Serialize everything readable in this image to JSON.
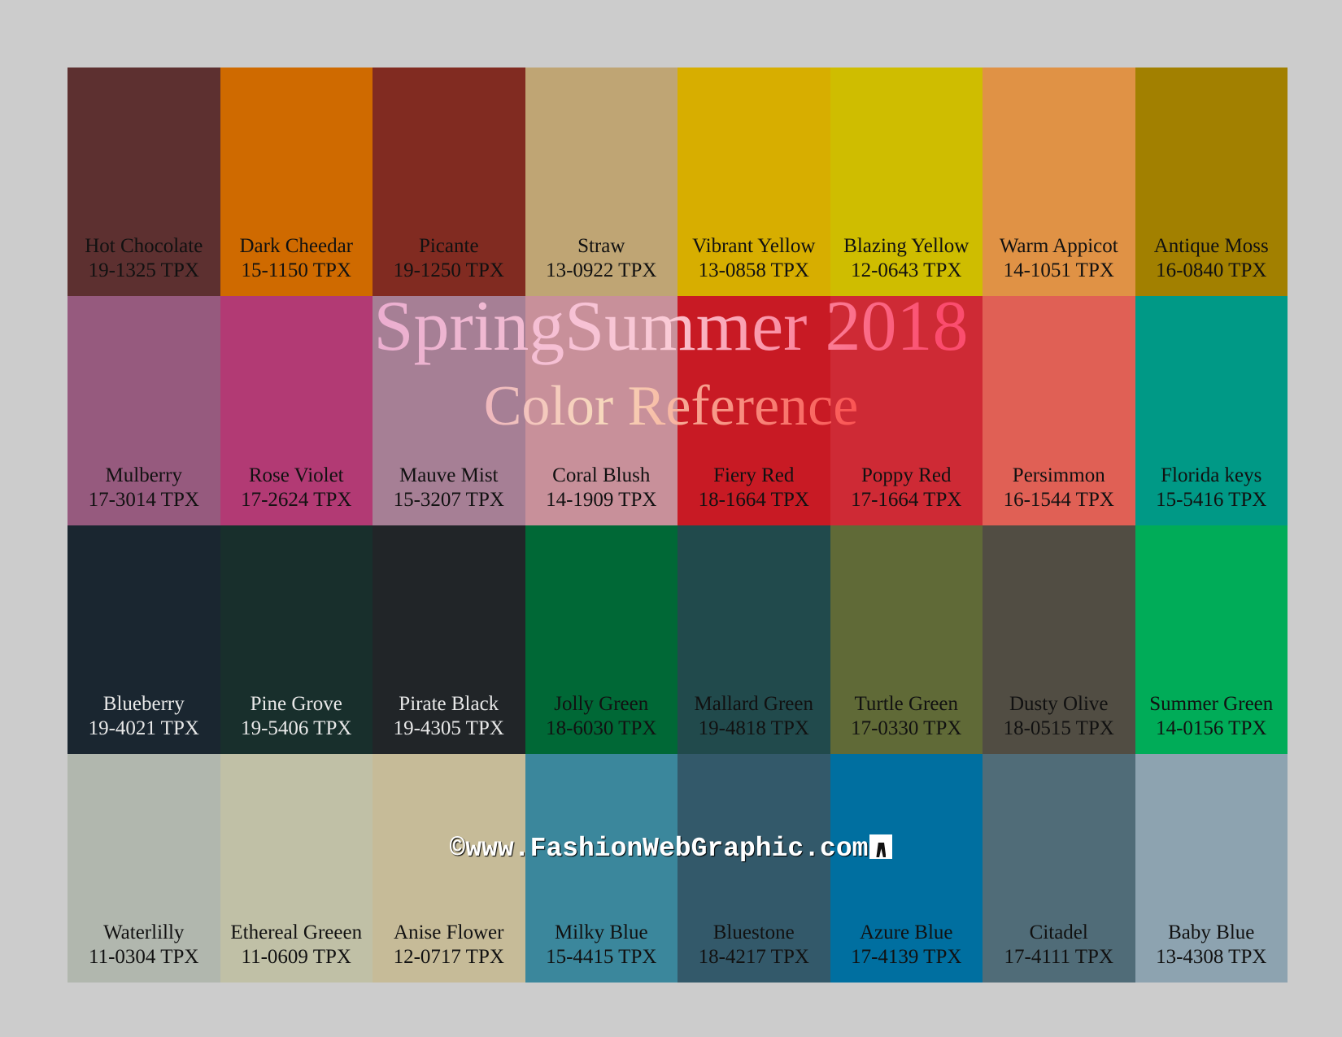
{
  "title": "SpringSummer 2018",
  "subtitle": "Color Reference",
  "watermark": "©www.FashionWebGraphic.com",
  "swatches": [
    {
      "name": "Hot Chocolate",
      "code": "19-1325 TPX",
      "color": "#5d3030",
      "text_color": "#111111"
    },
    {
      "name": "Dark Cheedar",
      "code": "15-1150 TPX",
      "color": "#cf6a00",
      "text_color": "#111111"
    },
    {
      "name": "Picante",
      "code": "19-1250 TPX",
      "color": "#812b21",
      "text_color": "#111111"
    },
    {
      "name": "Straw",
      "code": "13-0922 TPX",
      "color": "#bfa574",
      "text_color": "#111111"
    },
    {
      "name": "Vibrant Yellow",
      "code": "13-0858 TPX",
      "color": "#d7ae00",
      "text_color": "#111111"
    },
    {
      "name": "Blazing Yellow",
      "code": "12-0643 TPX",
      "color": "#cfbd00",
      "text_color": "#111111"
    },
    {
      "name": "Warm Appicot",
      "code": "14-1051 TPX",
      "color": "#e09245",
      "text_color": "#111111"
    },
    {
      "name": "Antique Moss",
      "code": "16-0840 TPX",
      "color": "#a28000",
      "text_color": "#111111"
    },
    {
      "name": "Mulberry",
      "code": "17-3014 TPX",
      "color": "#965a7e",
      "text_color": "#111111"
    },
    {
      "name": "Rose Violet",
      "code": "17-2624 TPX",
      "color": "#b23a74",
      "text_color": "#111111"
    },
    {
      "name": "Mauve Mist",
      "code": "15-3207 TPX",
      "color": "#a67f95",
      "text_color": "#111111"
    },
    {
      "name": "Coral Blush",
      "code": "14-1909 TPX",
      "color": "#c8909a",
      "text_color": "#111111"
    },
    {
      "name": "Fiery Red",
      "code": "18-1664 TPX",
      "color": "#c81a24",
      "text_color": "#111111"
    },
    {
      "name": "Poppy Red",
      "code": "17-1664 TPX",
      "color": "#ce2a35",
      "text_color": "#111111"
    },
    {
      "name": "Persimmon",
      "code": "16-1544 TPX",
      "color": "#e06055",
      "text_color": "#111111"
    },
    {
      "name": "Florida keys",
      "code": "15-5416 TPX",
      "color": "#009986",
      "text_color": "#111111"
    },
    {
      "name": "Blueberry",
      "code": "19-4021 TPX",
      "color": "#1a2630",
      "text_color": "#e8e8e8"
    },
    {
      "name": "Pine Grove",
      "code": "19-5406 TPX",
      "color": "#182f2c",
      "text_color": "#e8e8e8"
    },
    {
      "name": "Pirate Black",
      "code": "19-4305 TPX",
      "color": "#212528",
      "text_color": "#e8e8e8"
    },
    {
      "name": "Jolly Green",
      "code": "18-6030 TPX",
      "color": "#006836",
      "text_color": "#111111"
    },
    {
      "name": "Mallard Green",
      "code": "19-4818 TPX",
      "color": "#214a4c",
      "text_color": "#111111"
    },
    {
      "name": "Turtle Green",
      "code": "17-0330 TPX",
      "color": "#606a37",
      "text_color": "#111111"
    },
    {
      "name": "Dusty Olive",
      "code": "18-0515 TPX",
      "color": "#514d43",
      "text_color": "#111111"
    },
    {
      "name": "Summer Green",
      "code": "14-0156 TPX",
      "color": "#00ac58",
      "text_color": "#111111"
    },
    {
      "name": "Waterlilly",
      "code": "11-0304 TPX",
      "color": "#b1b7ae",
      "text_color": "#111111"
    },
    {
      "name": "Ethereal Greeen",
      "code": "11-0609 TPX",
      "color": "#c0c0a6",
      "text_color": "#111111"
    },
    {
      "name": "Anise Flower",
      "code": "12-0717 TPX",
      "color": "#c6bb98",
      "text_color": "#111111"
    },
    {
      "name": "Milky Blue",
      "code": "15-4415 TPX",
      "color": "#3b879c",
      "text_color": "#111111"
    },
    {
      "name": "Bluestone",
      "code": "18-4217 TPX",
      "color": "#33596a",
      "text_color": "#111111"
    },
    {
      "name": "Azure Blue",
      "code": "17-4139 TPX",
      "color": "#006fa0",
      "text_color": "#111111"
    },
    {
      "name": "Citadel",
      "code": "17-4111 TPX",
      "color": "#506c78",
      "text_color": "#111111"
    },
    {
      "name": "Baby Blue",
      "code": "13-4308 TPX",
      "color": "#8da3b0",
      "text_color": "#111111"
    }
  ]
}
